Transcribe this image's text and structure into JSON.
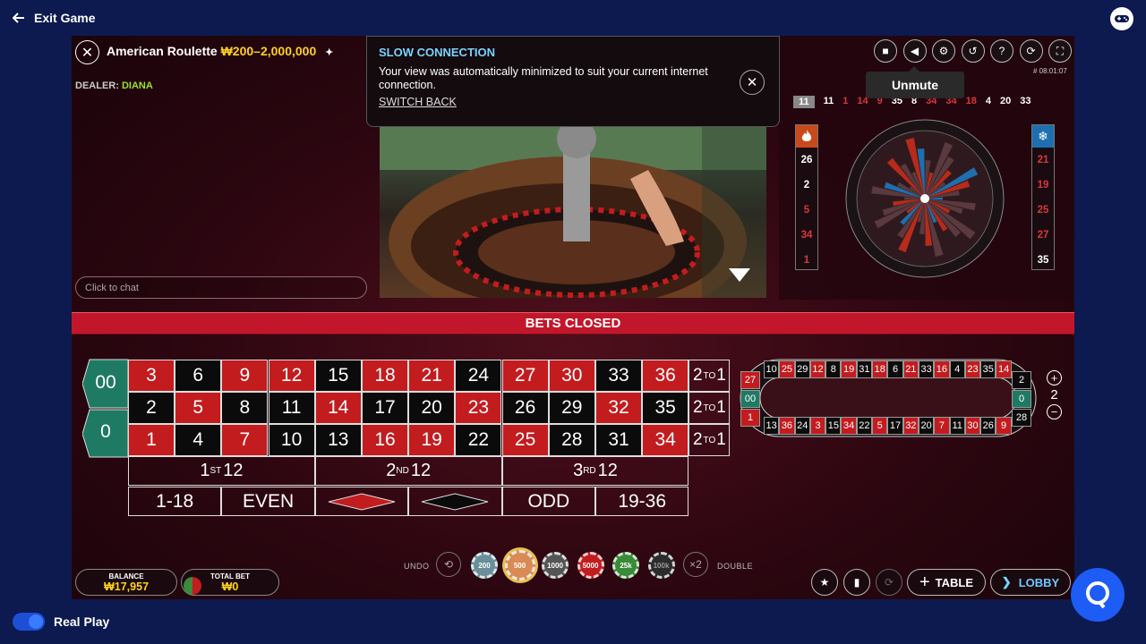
{
  "topbar": {
    "exit_label": "Exit Game"
  },
  "game": {
    "title": "American Roulette",
    "limits": "₩200–2,000,000",
    "dealer_label": "DEALER:",
    "dealer_name": "DIANA"
  },
  "chat": {
    "placeholder": "Click to chat"
  },
  "notice": {
    "title": "SLOW CONNECTION",
    "message": "Your view was automatically minimized to suit your current internet connection.",
    "link": "SWITCH BACK"
  },
  "controls": {
    "game_id": "# 08:01:07",
    "tooltip": "Unmute"
  },
  "recent_results": [
    {
      "n": "11",
      "c": "black"
    },
    {
      "n": "11",
      "c": "black"
    },
    {
      "n": "1",
      "c": "red"
    },
    {
      "n": "14",
      "c": "red"
    },
    {
      "n": "9",
      "c": "red"
    },
    {
      "n": "35",
      "c": "black"
    },
    {
      "n": "8",
      "c": "black"
    },
    {
      "n": "34",
      "c": "red"
    },
    {
      "n": "34",
      "c": "red"
    },
    {
      "n": "18",
      "c": "red"
    },
    {
      "n": "4",
      "c": "black"
    },
    {
      "n": "20",
      "c": "black"
    },
    {
      "n": "33",
      "c": "black"
    }
  ],
  "hot_numbers": [
    {
      "n": "26",
      "c": "black"
    },
    {
      "n": "2",
      "c": "black"
    },
    {
      "n": "5",
      "c": "red"
    },
    {
      "n": "34",
      "c": "red"
    },
    {
      "n": "1",
      "c": "red"
    }
  ],
  "cold_numbers": [
    {
      "n": "21",
      "c": "red"
    },
    {
      "n": "19",
      "c": "red"
    },
    {
      "n": "25",
      "c": "red"
    },
    {
      "n": "27",
      "c": "red"
    },
    {
      "n": "35",
      "c": "black"
    }
  ],
  "banner": "BETS CLOSED",
  "board": {
    "zero_top": "00",
    "zero_bottom": "0",
    "rows": [
      [
        {
          "n": "3",
          "c": "red"
        },
        {
          "n": "6",
          "c": "black"
        },
        {
          "n": "9",
          "c": "red"
        },
        {
          "n": "12",
          "c": "red"
        },
        {
          "n": "15",
          "c": "black"
        },
        {
          "n": "18",
          "c": "red"
        },
        {
          "n": "21",
          "c": "red"
        },
        {
          "n": "24",
          "c": "black"
        },
        {
          "n": "27",
          "c": "red"
        },
        {
          "n": "30",
          "c": "red"
        },
        {
          "n": "33",
          "c": "black"
        },
        {
          "n": "36",
          "c": "red"
        }
      ],
      [
        {
          "n": "2",
          "c": "black"
        },
        {
          "n": "5",
          "c": "red"
        },
        {
          "n": "8",
          "c": "black"
        },
        {
          "n": "11",
          "c": "black"
        },
        {
          "n": "14",
          "c": "red"
        },
        {
          "n": "17",
          "c": "black"
        },
        {
          "n": "20",
          "c": "black"
        },
        {
          "n": "23",
          "c": "red"
        },
        {
          "n": "26",
          "c": "black"
        },
        {
          "n": "29",
          "c": "black"
        },
        {
          "n": "32",
          "c": "red"
        },
        {
          "n": "35",
          "c": "black"
        }
      ],
      [
        {
          "n": "1",
          "c": "red"
        },
        {
          "n": "4",
          "c": "black"
        },
        {
          "n": "7",
          "c": "red"
        },
        {
          "n": "10",
          "c": "black"
        },
        {
          "n": "13",
          "c": "black"
        },
        {
          "n": "16",
          "c": "red"
        },
        {
          "n": "19",
          "c": "red"
        },
        {
          "n": "22",
          "c": "black"
        },
        {
          "n": "25",
          "c": "red"
        },
        {
          "n": "28",
          "c": "black"
        },
        {
          "n": "31",
          "c": "black"
        },
        {
          "n": "34",
          "c": "red"
        }
      ]
    ],
    "column_bet": {
      "a": "2",
      "b": "TO",
      "c": "1"
    },
    "dozens": [
      {
        "num": "1",
        "sup": "ST",
        "val": "12"
      },
      {
        "num": "2",
        "sup": "ND",
        "val": "12"
      },
      {
        "num": "3",
        "sup": "RD",
        "val": "12"
      }
    ],
    "outside": {
      "low": "1-18",
      "even": "EVEN",
      "odd": "ODD",
      "high": "19-36"
    }
  },
  "racetrack": {
    "top": [
      {
        "n": "10",
        "c": "black"
      },
      {
        "n": "25",
        "c": "red"
      },
      {
        "n": "29",
        "c": "black"
      },
      {
        "n": "12",
        "c": "red"
      },
      {
        "n": "8",
        "c": "black"
      },
      {
        "n": "19",
        "c": "red"
      },
      {
        "n": "31",
        "c": "black"
      },
      {
        "n": "18",
        "c": "red"
      },
      {
        "n": "6",
        "c": "black"
      },
      {
        "n": "21",
        "c": "red"
      },
      {
        "n": "33",
        "c": "black"
      },
      {
        "n": "16",
        "c": "red"
      },
      {
        "n": "4",
        "c": "black"
      },
      {
        "n": "23",
        "c": "red"
      },
      {
        "n": "35",
        "c": "black"
      },
      {
        "n": "14",
        "c": "red"
      }
    ],
    "bottom": [
      {
        "n": "13",
        "c": "black"
      },
      {
        "n": "36",
        "c": "red"
      },
      {
        "n": "24",
        "c": "black"
      },
      {
        "n": "3",
        "c": "red"
      },
      {
        "n": "15",
        "c": "black"
      },
      {
        "n": "34",
        "c": "red"
      },
      {
        "n": "22",
        "c": "black"
      },
      {
        "n": "5",
        "c": "red"
      },
      {
        "n": "17",
        "c": "black"
      },
      {
        "n": "32",
        "c": "red"
      },
      {
        "n": "20",
        "c": "black"
      },
      {
        "n": "7",
        "c": "red"
      },
      {
        "n": "11",
        "c": "black"
      },
      {
        "n": "30",
        "c": "red"
      },
      {
        "n": "26",
        "c": "black"
      },
      {
        "n": "9",
        "c": "red"
      }
    ],
    "left": [
      {
        "n": "27",
        "c": "red"
      },
      {
        "n": "00",
        "c": "green"
      },
      {
        "n": "1",
        "c": "red"
      }
    ],
    "right": [
      {
        "n": "2",
        "c": "black"
      },
      {
        "n": "0",
        "c": "green"
      },
      {
        "n": "28",
        "c": "black"
      }
    ],
    "neighbours": "2"
  },
  "footer": {
    "balance_label": "BALANCE",
    "balance": "₩17,957",
    "total_bet_label": "TOTAL BET",
    "total_bet": "₩0",
    "undo": "UNDO",
    "double": "DOUBLE",
    "double_icon": "×2",
    "chips": [
      {
        "label": "200",
        "color": "#6a8f9a"
      },
      {
        "label": "500",
        "color": "#d98a55"
      },
      {
        "label": "1000",
        "color": "#555555"
      },
      {
        "label": "5000",
        "color": "#c31c1f"
      },
      {
        "label": "25k",
        "color": "#3a8a3a"
      },
      {
        "label": "100k",
        "color": "#2c2c2c"
      }
    ],
    "table_btn": "TABLE",
    "lobby_btn": "LOBBY",
    "mode": "Real Play"
  },
  "colors": {
    "red": "#c31c1f",
    "black": "#0b0b0b",
    "green": "#1f7a64",
    "gold": "#ffd21f",
    "accent": "#1d5cf5"
  }
}
